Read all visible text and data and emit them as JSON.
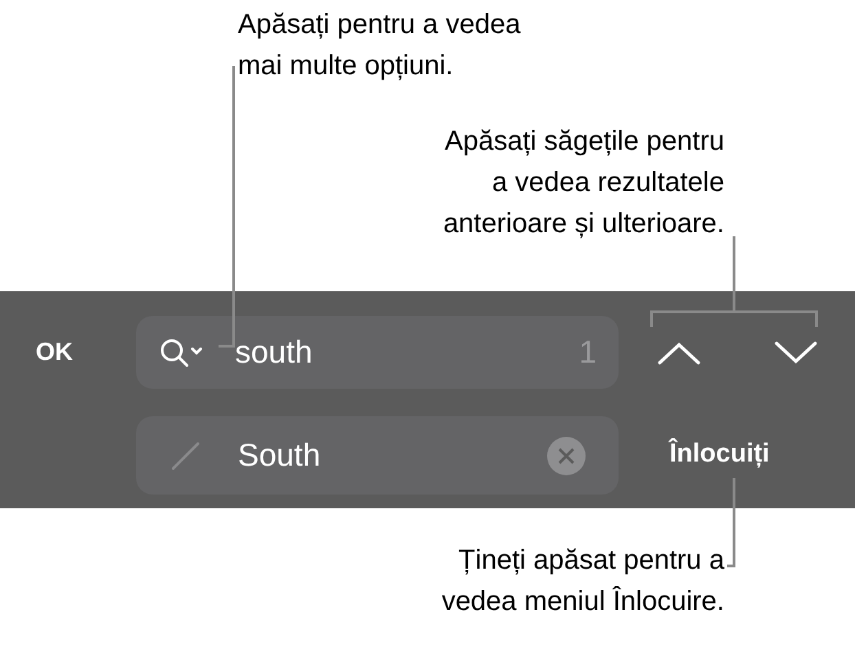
{
  "callouts": [
    {
      "kind": "left",
      "lines": [
        "Apăsați pentru a vedea",
        "mai multe opțiuni."
      ]
    },
    {
      "kind": "right",
      "lines": [
        "Apăsați săgețile pentru",
        "a vedea rezultatele",
        "anterioare și ulterioare."
      ]
    },
    {
      "kind": "bottom",
      "lines": [
        "Țineți apăsat pentru a",
        "vedea meniul Înlocuire."
      ]
    }
  ],
  "toolbar": {
    "done_button": "OK",
    "search": {
      "value": "south",
      "count": "1"
    },
    "replace": {
      "value": "South"
    },
    "replace_button": "Înlocuiți"
  }
}
